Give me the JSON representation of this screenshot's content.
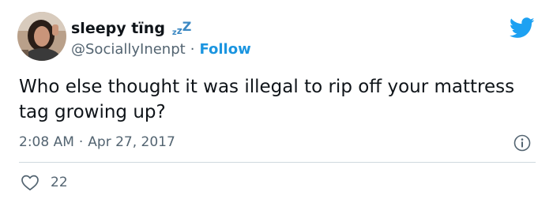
{
  "author": {
    "display_name": "sleepy tïng",
    "zzz": [
      "z",
      "z",
      "Z"
    ],
    "handle": "@SociallyInenpt",
    "separator": "·",
    "follow_label": "Follow"
  },
  "tweet": {
    "text": "Who else thought it was illegal to rip off your mattress tag growing up?",
    "time": "2:08 AM",
    "separator": "·",
    "date": "Apr 27, 2017"
  },
  "engagement": {
    "likes": "22"
  },
  "icons": {
    "brand": "twitter-bird-icon",
    "info": "info-icon",
    "like": "heart-icon"
  },
  "colors": {
    "brand_blue": "#1da1f2",
    "link_blue": "#1b95e0",
    "secondary_text": "#536471",
    "primary_text": "#0f1419",
    "divider": "#cfd9de"
  }
}
